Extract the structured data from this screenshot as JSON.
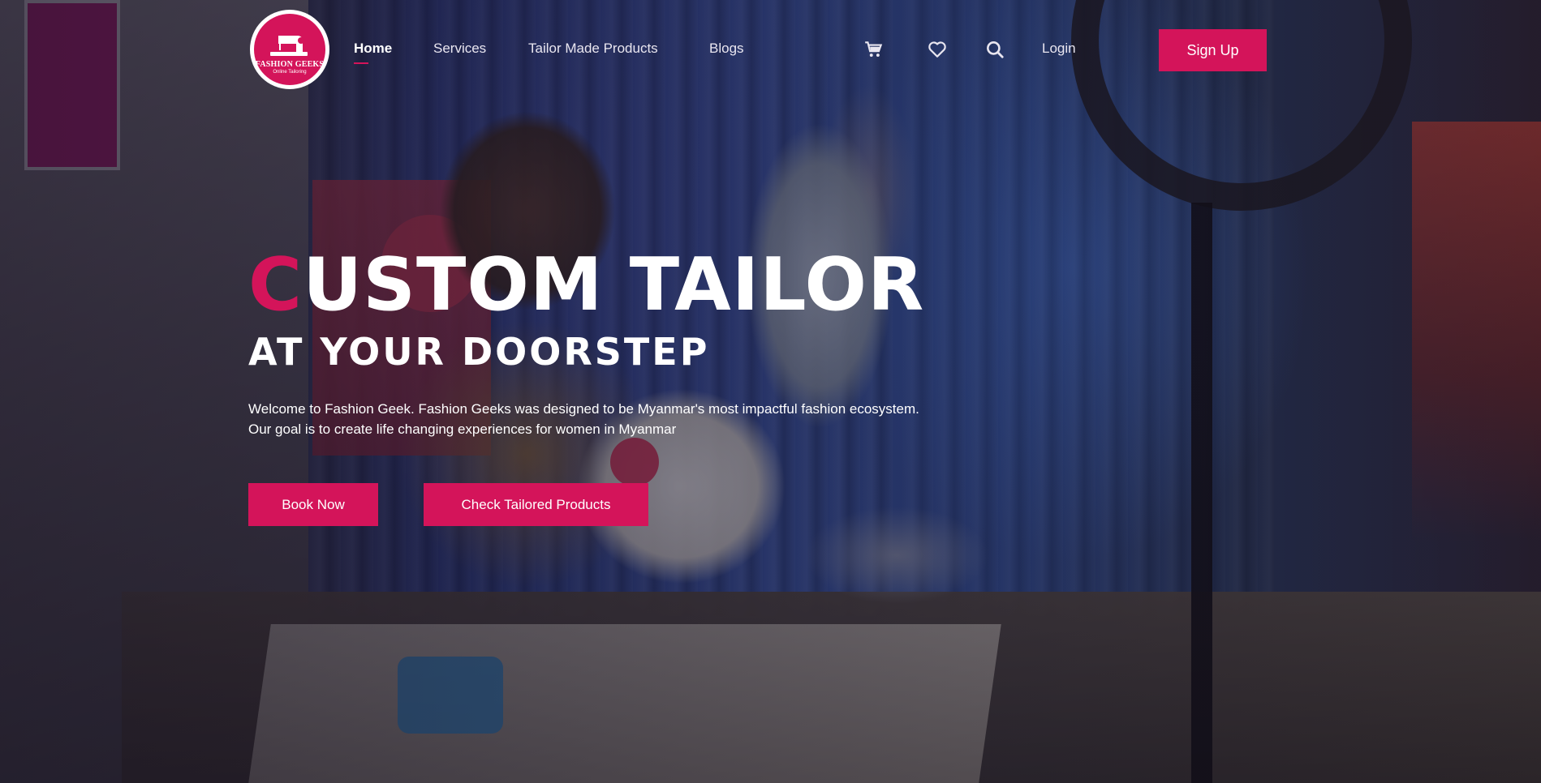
{
  "brand": {
    "name": "FASHION GEEKS",
    "tagline": "Online Tailoring",
    "accent_color": "#d4145a"
  },
  "nav": {
    "items": [
      {
        "label": "Home",
        "active": true
      },
      {
        "label": "Services",
        "active": false
      },
      {
        "label": "Tailor Made Products",
        "active": false
      },
      {
        "label": "Blogs",
        "active": false
      }
    ],
    "icons": [
      "cart-icon",
      "heart-icon",
      "search-icon"
    ],
    "login_label": "Login",
    "signup_label": "Sign Up"
  },
  "hero": {
    "title_first_letter": "C",
    "title_rest": "USTOM TAILOR",
    "subtitle": "AT YOUR DOORSTEP",
    "description_line1": "Welcome to Fashion Geek. Fashion Geeks was designed to be Myanmar's most impactful fashion ecosystem.",
    "description_line2": "Our goal is to create life changing experiences for women in Myanmar",
    "primary_button": "Book Now",
    "secondary_button": "Check Tailored Products"
  }
}
